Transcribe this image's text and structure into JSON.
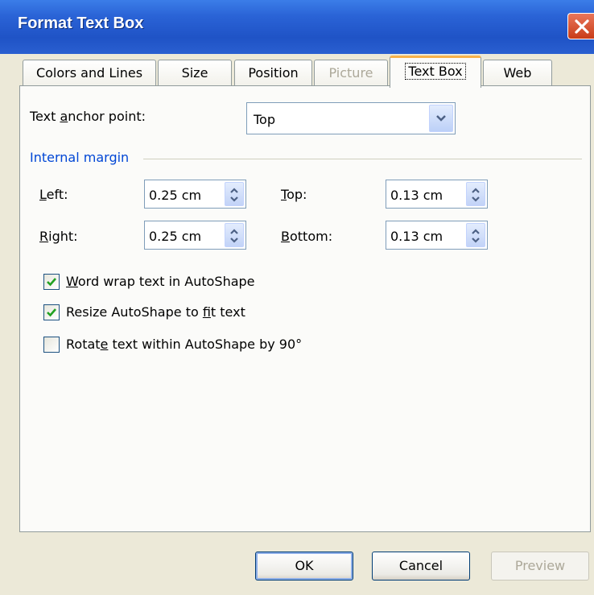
{
  "window": {
    "title": "Format Text Box"
  },
  "tabs": [
    {
      "label": "Colors and Lines",
      "state": "normal"
    },
    {
      "label": "Size",
      "state": "normal"
    },
    {
      "label": "Position",
      "state": "normal"
    },
    {
      "label": "Picture",
      "state": "disabled"
    },
    {
      "label": "Text Box",
      "state": "active"
    },
    {
      "label": "Web",
      "state": "normal"
    }
  ],
  "anchor": {
    "label_pre": "Text ",
    "label_key": "a",
    "label_post": "nchor point:",
    "value": "Top"
  },
  "margin": {
    "group_label": "Internal margin",
    "left": {
      "label_key": "L",
      "label_post": "eft:",
      "value": "0.25 cm"
    },
    "right": {
      "label_key": "R",
      "label_post": "ight:",
      "value": "0.25 cm"
    },
    "top": {
      "label_key": "T",
      "label_post": "op:",
      "value": "0.13 cm"
    },
    "bottom": {
      "label_key": "B",
      "label_post": "ottom:",
      "value": "0.13 cm"
    }
  },
  "options": {
    "word_wrap": {
      "pre": "",
      "key": "W",
      "post": "ord wrap text in AutoShape",
      "checked": true
    },
    "resize": {
      "pre": "Resize AutoShape to ",
      "key": "f",
      "post": "it text",
      "checked": true
    },
    "rotate": {
      "pre": "Rotat",
      "key": "e",
      "post": " text within AutoShape by 90°",
      "checked": false
    }
  },
  "buttons": {
    "ok": "OK",
    "cancel": "Cancel",
    "preview": "Preview"
  },
  "colors": {
    "title_bar": "#2a63d6",
    "group_label": "#0046d5",
    "check_mark": "#21a121",
    "active_tab_accent": "#f7b24a"
  }
}
